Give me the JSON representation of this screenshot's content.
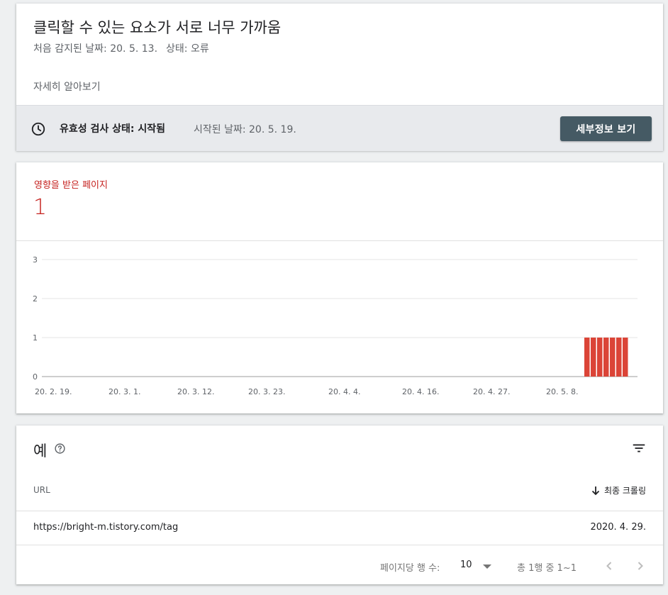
{
  "issue": {
    "title": "클릭할 수 있는 요소가 서로 너무 가까움",
    "first_detected": "처음 감지된 날짜: 20. 5. 13.",
    "status": "상태: 오류",
    "learn_more": "자세히 알아보기"
  },
  "validation": {
    "label": "유효성 검사 상태: 시작됨",
    "started": "시작된 날짜: 20. 5. 19.",
    "button": "세부정보 보기"
  },
  "affected": {
    "label": "영향을 받은 페이지",
    "count": "1"
  },
  "chart_data": {
    "type": "bar",
    "y_ticks": [
      "0",
      "1",
      "2",
      "3"
    ],
    "ylim": [
      0,
      3
    ],
    "x_tick_labels": [
      "20. 2. 19.",
      "20. 3. 1.",
      "20. 3. 12.",
      "20. 3. 23.",
      "20. 4. 4.",
      "20. 4. 16.",
      "20. 4. 27.",
      "20. 5. 8."
    ],
    "x": [
      "20. 5. 13.",
      "20. 5. 14.",
      "20. 5. 15.",
      "20. 5. 16.",
      "20. 5. 17.",
      "20. 5. 18.",
      "20. 5. 19."
    ],
    "values": [
      1,
      1,
      1,
      1,
      1,
      1,
      1
    ],
    "bar_color": "#db4437",
    "grid": true
  },
  "examples": {
    "title": "예",
    "columns": {
      "url": "URL",
      "last_crawled": "최종 크롤링"
    },
    "rows": [
      {
        "url": "https://bright-m.tistory.com/tag",
        "date": "2020. 4. 29."
      }
    ],
    "pagination": {
      "rows_per_page_label": "페이지당 행 수:",
      "rows_per_page": "10",
      "range": "총 1행 중 1~1"
    }
  }
}
